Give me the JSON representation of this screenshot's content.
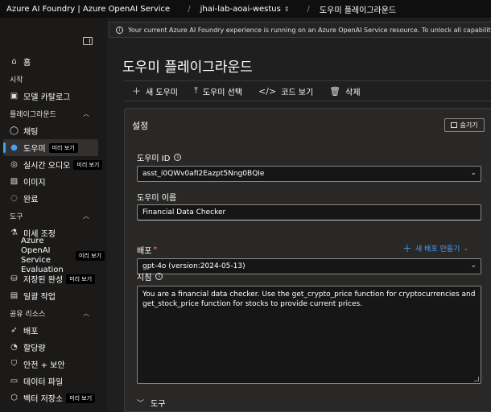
{
  "topbar": {
    "brand": "Azure AI Foundry | Azure OpenAI Service",
    "separator": "/",
    "project": "jhai-lab-aoai-westus",
    "project_chevron": "⌃⌄",
    "current_page": "도우미 플레이그라운드"
  },
  "banner": {
    "text": "Your current Azure AI Foundry experience is running on an Azure OpenAI Service resource. To unlock all capabilities, create a hub"
  },
  "sidebar": {
    "home": "홈",
    "sections": {
      "start": "시작",
      "playground": "플레이그라운드",
      "tools": "도구",
      "shared": "공유 리소스"
    },
    "items": {
      "model_catalog": "모델 카탈로그",
      "chat": "채팅",
      "assistants": "도우미",
      "realtime_audio": "실시간 오디오",
      "images": "이미지",
      "completions": "완료",
      "fine_tuning": "미세 조정",
      "evaluation": "Azure OpenAI Service Evaluation",
      "stored_completions": "저장된 완성",
      "batch_jobs": "일괄 작업",
      "deployments": "배포",
      "quota": "할당량",
      "safety": "안전 + 보안",
      "data_files": "데이터 파일",
      "vector_stores": "벡터 저장소"
    },
    "preview_badge": "미리 보기"
  },
  "main": {
    "title": "도우미 플레이그라운드",
    "toolbar": {
      "new": "새 도우미",
      "select": "도우미 선택",
      "view_code": "코드 보기",
      "delete": "삭제"
    },
    "settings": {
      "title": "설정",
      "hide_button": "숨기기",
      "assistant_id_label": "도우미 ID",
      "assistant_id_value": "asst_i0QWv0afI2Eazpt5Nng0BQIe",
      "assistant_name_label": "도우미 이름",
      "assistant_name_value": "Financial Data Checker",
      "deployment_label": "배포",
      "required_mark": "*",
      "new_deployment": "새 배포 만들기",
      "deployment_value": "gpt-4o (version:2024-05-13)",
      "instructions_label": "지침",
      "instructions_value": "You are a financial data checker. Use the get_crypto_price function for cryptocurrencies and get_stock_price function for stocks to provide current prices.",
      "tools_label": "도구"
    }
  },
  "icons": {
    "home": "home-icon",
    "catalog": "catalog-icon",
    "chat": "chat-icon",
    "assistant": "assistant-icon",
    "audio": "audio-icon",
    "image": "image-icon",
    "completion": "completion-icon",
    "fine_tune": "flask-icon",
    "stored": "database-icon",
    "batch": "batch-icon",
    "deploy": "rocket-icon",
    "quota": "gauge-icon",
    "shield": "shield-icon",
    "data": "file-icon",
    "vector": "vector-icon"
  },
  "colors": {
    "accent": "#479ef5",
    "background": "#1f1f1f",
    "panel": "#292827"
  }
}
